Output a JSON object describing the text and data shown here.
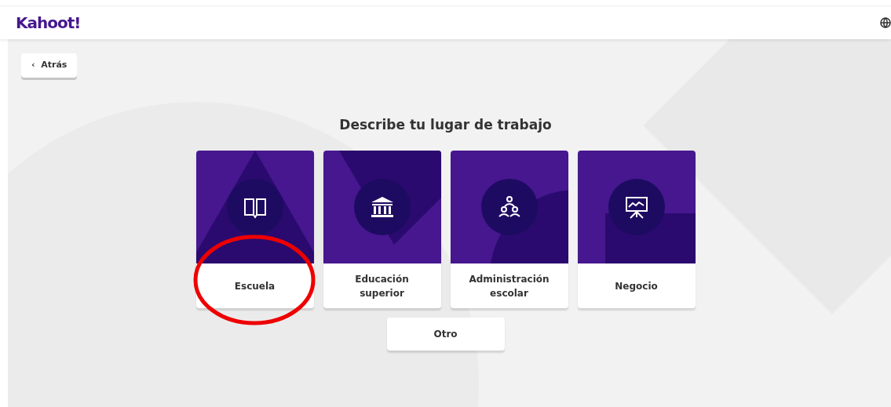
{
  "header": {
    "logo": "Kahoot!"
  },
  "back_button": {
    "label": "Atrás",
    "arrow": "‹"
  },
  "title": "Describe tu lugar de trabajo",
  "cards": [
    {
      "label": "Escuela",
      "circled": true
    },
    {
      "label": "Educación superior",
      "circled": false
    },
    {
      "label": "Administración escolar",
      "circled": false
    },
    {
      "label": "Negocio",
      "circled": false
    }
  ],
  "other_button": {
    "label": "Otro"
  }
}
